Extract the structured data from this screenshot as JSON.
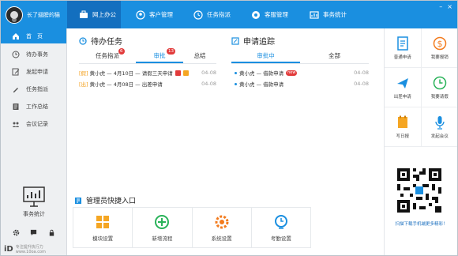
{
  "window": {
    "username": "长了翅膀的猫"
  },
  "nav": {
    "items": [
      {
        "label": "网上办公",
        "icon": "briefcase-icon",
        "active": true
      },
      {
        "label": "客户管理",
        "icon": "customer-icon",
        "active": false
      },
      {
        "label": "任务指派",
        "icon": "task-icon",
        "active": false
      },
      {
        "label": "客服管理",
        "icon": "service-icon",
        "active": false
      },
      {
        "label": "事务统计",
        "icon": "stats-icon",
        "active": false
      }
    ]
  },
  "sidebar": {
    "items": [
      {
        "label": "首　页",
        "icon": "home-icon"
      },
      {
        "label": "待办事务",
        "icon": "pending-icon"
      },
      {
        "label": "发起申请",
        "icon": "apply-icon"
      },
      {
        "label": "任务指派",
        "icon": "task-assign-icon"
      },
      {
        "label": "工作总结",
        "icon": "summary-icon"
      },
      {
        "label": "会议记录",
        "icon": "meeting-icon"
      }
    ],
    "stats_label": "事务统计",
    "footer_logo": "iD",
    "footer_text": "专注提升执行力",
    "footer_url": "www.10oa.com"
  },
  "todo": {
    "title": "待办任务",
    "tabs": [
      {
        "label": "任务指派",
        "badge": "6"
      },
      {
        "label": "审批",
        "badge": "13"
      },
      {
        "label": "总结",
        "badge": ""
      }
    ],
    "rows": [
      {
        "tag": "[假]",
        "text": "黄小虎 — 4月10日 — 请假三天申请",
        "date": "04-08"
      },
      {
        "tag": "[出]",
        "text": "黄小虎 — 4月08日 — 出差申请",
        "date": "04-08"
      }
    ]
  },
  "tracking": {
    "title": "申请追踪",
    "tabs": [
      {
        "label": "审批中"
      },
      {
        "label": "全部"
      }
    ],
    "rows": [
      {
        "text": "黄小虎 — 借款申请",
        "new": "new",
        "date": "04-08"
      },
      {
        "text": "黄小虎 — 借款申请",
        "new": "",
        "date": "04-08"
      }
    ]
  },
  "quick": {
    "title": "管理员快捷入口",
    "items": [
      {
        "label": "模块设置",
        "icon": "module-icon",
        "color": "#f5a623"
      },
      {
        "label": "新增流程",
        "icon": "add-flow-icon",
        "color": "#2ab35a"
      },
      {
        "label": "系统设置",
        "icon": "system-gear-icon",
        "color": "#f37b1d"
      },
      {
        "label": "考勤设置",
        "icon": "attendance-clock-icon",
        "color": "#1a8fe0"
      }
    ]
  },
  "right": {
    "items": [
      {
        "label": "普通申请",
        "icon": "document-icon",
        "color": "#1a8fe0"
      },
      {
        "label": "我要报销",
        "icon": "dollar-icon",
        "color": "#f37b1d"
      },
      {
        "label": "出差申请",
        "icon": "airplane-icon",
        "color": "#1a8fe0"
      },
      {
        "label": "我要请假",
        "icon": "clock-icon",
        "color": "#2ab35a"
      },
      {
        "label": "写日报",
        "icon": "notepad-icon",
        "color": "#f5a623"
      },
      {
        "label": "发起会议",
        "icon": "microphone-icon",
        "color": "#1a8fe0"
      }
    ],
    "qr_caption": "扫描下载手机端更多精彩！"
  },
  "colors": {
    "brand": "#1a8fe0",
    "brand_dark": "#136fbf",
    "badge": "#e23b3b"
  }
}
